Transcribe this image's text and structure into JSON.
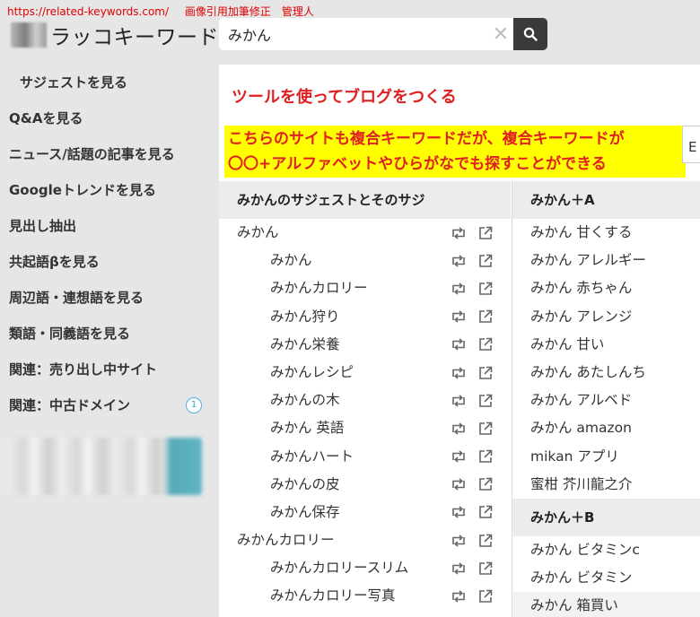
{
  "watermark": {
    "url": "https://related-keywords.com/",
    "note": "画像引用加筆修正　管理人"
  },
  "logo": {
    "text": "ラッコキーワード"
  },
  "search": {
    "value": "みかん"
  },
  "sidebar": {
    "items": [
      {
        "label": "サジェストを見る"
      },
      {
        "label": "Q&Aを見る"
      },
      {
        "label": "ニュース/話題の記事を見る"
      },
      {
        "label": "Googleトレンドを見る"
      },
      {
        "label": "見出し抽出"
      },
      {
        "label": "共起語βを見る"
      },
      {
        "label": "周辺語・連想語を見る"
      },
      {
        "label": "類語・同義語を見る"
      },
      {
        "label": "関連：売り出し中サイト"
      },
      {
        "label": "関連：中古ドメイン",
        "badge": "1"
      }
    ]
  },
  "banner": {
    "title": "ツールを使ってブログをつくる",
    "line1": "こちらのサイトも複合キーワードだが、複合キーワードが",
    "line2": "〇〇+アルファベットやひらがなでも探すことができる",
    "peek": "E"
  },
  "col1": {
    "heading": "みかんのサジェストとそのサジ",
    "rows": [
      {
        "text": "みかん",
        "child": false
      },
      {
        "text": "みかん",
        "child": true
      },
      {
        "text": "みかんカロリー",
        "child": true
      },
      {
        "text": "みかん狩り",
        "child": true
      },
      {
        "text": "みかん栄養",
        "child": true
      },
      {
        "text": "みかんレシピ",
        "child": true
      },
      {
        "text": "みかんの木",
        "child": true
      },
      {
        "text": "みかん 英語",
        "child": true
      },
      {
        "text": "みかんハート",
        "child": true
      },
      {
        "text": "みかんの皮",
        "child": true
      },
      {
        "text": "みかん保存",
        "child": true
      },
      {
        "text": "みかんカロリー",
        "child": false
      },
      {
        "text": "みかんカロリースリム",
        "child": true
      },
      {
        "text": "みかんカロリー写真",
        "child": true
      }
    ]
  },
  "col2": {
    "heading_a": "みかん＋A",
    "rows_a": [
      "みかん 甘くする",
      "みかん アレルギー",
      "みかん 赤ちゃん",
      "みかん アレンジ",
      "みかん 甘い",
      "みかん あたしんち",
      "みかん アルベド",
      "みかん amazon",
      "mikan アプリ",
      "蜜柑 芥川龍之介"
    ],
    "heading_b": "みかん＋B",
    "rows_b": [
      "みかん ビタミンc",
      "みかん ビタミン",
      "みかん 箱買い"
    ]
  }
}
